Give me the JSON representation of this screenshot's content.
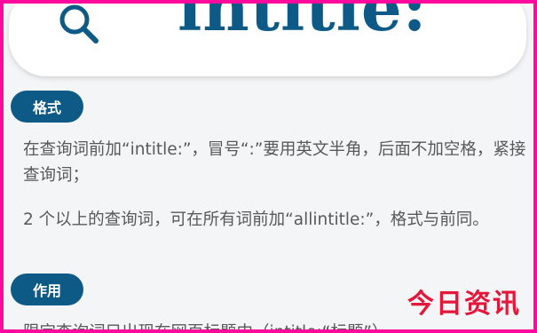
{
  "search": {
    "keyword": "intitle:"
  },
  "sections": [
    {
      "badge": "格式",
      "paragraphs": [
        "在查询词前加“intitle:”，冒号“:”要用英文半角，后面不加空格，紧接查询词；",
        "2 个以上的查询词，可在所有词前加“allintitle:”，格式与前同。"
      ]
    },
    {
      "badge": "作用",
      "paragraphs": [
        "限定查询词只出现在网页标题中（intitle:“标题”）。"
      ]
    }
  ],
  "watermark": "今日资讯",
  "colors": {
    "accent": "#0e5a86",
    "border": "#ff0a9c",
    "watermark": "#e4163a",
    "text": "#595959"
  }
}
